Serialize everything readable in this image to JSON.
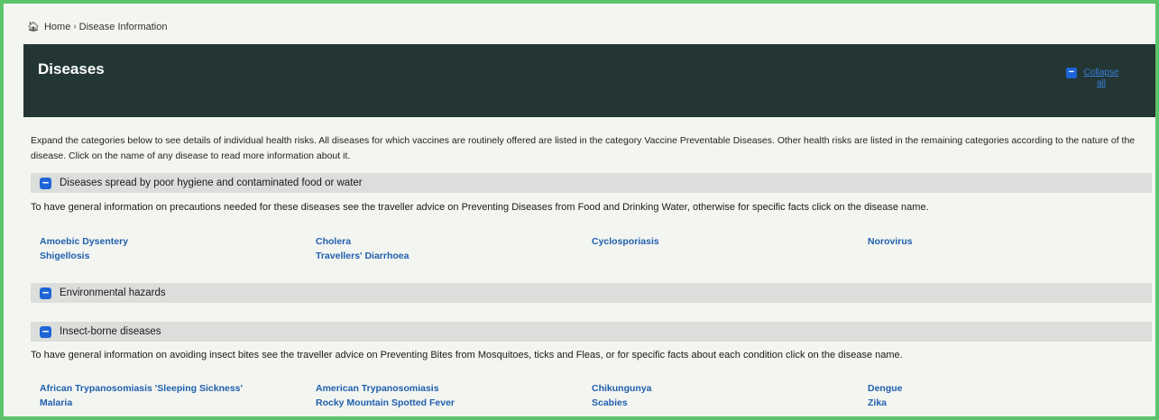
{
  "breadcrumb": {
    "home": "Home",
    "separator": "›",
    "current": "Disease Information"
  },
  "banner": {
    "title": "Diseases",
    "collapse_symbol": "−",
    "collapse_label": "Collapse all"
  },
  "intro": "Expand the categories below to see details of individual health risks. All diseases for which vaccines are routinely offered are listed in the category Vaccine Preventable Diseases. Other health risks are listed in the remaining categories according to the nature of the disease. Click on the name of any disease to read more information about it.",
  "sections": [
    {
      "toggle": "−",
      "title": "Diseases spread by poor hygiene and contaminated food or water",
      "description": "To have general information on precautions needed for these diseases see the traveller advice on Preventing Diseases from Food and Drinking Water, otherwise for specific facts click on the disease name.",
      "diseases": [
        "Amoebic Dysentery",
        "Cholera",
        "Cyclosporiasis",
        "Norovirus",
        "Shigellosis",
        "Travellers' Diarrhoea"
      ]
    },
    {
      "toggle": "−",
      "title": "Environmental hazards"
    },
    {
      "toggle": "−",
      "title": "Insect-borne diseases",
      "description": "To have general information on avoiding insect bites see the traveller advice on Preventing Bites from Mosquitoes, ticks and Fleas, or for specific facts about each condition click on the disease name.",
      "diseases": [
        "African Trypanosomiasis 'Sleeping Sickness'",
        "American Trypanosomiasis",
        "Chikungunya",
        "Dengue",
        "Malaria",
        "Rocky Mountain Spotted Fever",
        "Scabies",
        "Zika"
      ]
    }
  ],
  "colors": {
    "frame": "#5cc36b",
    "banner": "#233633",
    "section_bar": "#dcdedb",
    "toggle": "#1e64d6",
    "link": "#1f5fae"
  },
  "icons": {
    "home": "home-icon",
    "toggle": "minus-box-icon"
  }
}
